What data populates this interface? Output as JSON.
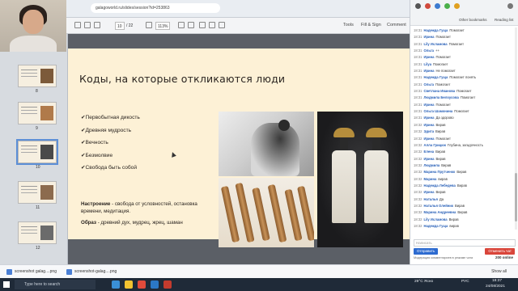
{
  "browser": {
    "address": "galagoworld.ru/slides/session?id=253863"
  },
  "pdf_toolbar": {
    "page_current": "10",
    "page_total": "/ 22",
    "zoom": "113%",
    "tools_label": "Tools",
    "fill_sign_label": "Fill & Sign",
    "comment_label": "Comment"
  },
  "thumbnails": {
    "page_numbers": [
      "8",
      "9",
      "10",
      "11",
      "12"
    ]
  },
  "slide": {
    "title": "Коды, на которые откликаются люди",
    "bullets": [
      "✔Первобытная дикость",
      "✔Древняя мудрость",
      "✔Вечность",
      "✔Безмолвие",
      "✔Свобода быть собой"
    ],
    "mood_label": "Настроение",
    "mood_text": " - свобода от условностей, остановка времени, медитация.",
    "image_label": "Образ",
    "image_text": " - древний дух, мудрец, жрец, шаман"
  },
  "chat": {
    "bookmarks": "Other bookmarks",
    "reading_list": "Reading list",
    "messages": [
      {
        "time": "18:31",
        "name": "Надежда Гуща",
        "text": "Помогает"
      },
      {
        "time": "18:31",
        "name": "Ирина",
        "text": "Помогает"
      },
      {
        "time": "18:31",
        "name": "Lily Исламова",
        "text": "Помогает"
      },
      {
        "time": "18:31",
        "name": "Ольга",
        "text": "++"
      },
      {
        "time": "18:31",
        "name": "Ирина",
        "text": "Помогает"
      },
      {
        "time": "18:31",
        "name": "Lilya",
        "text": "Помогает"
      },
      {
        "time": "18:31",
        "name": "Ирина",
        "text": "Не помогает"
      },
      {
        "time": "18:31",
        "name": "Надежда Гуща",
        "text": "Помогает понять"
      },
      {
        "time": "18:31",
        "name": "Ольга",
        "text": "Помогает"
      },
      {
        "time": "18:31",
        "name": "Светлана Иванова",
        "text": "Помогает"
      },
      {
        "time": "18:31",
        "name": "Людмила Белоусова",
        "text": "Помогает"
      },
      {
        "time": "18:31",
        "name": "Ирина",
        "text": "Помогает"
      },
      {
        "time": "18:31",
        "name": "Ольга Шамонина",
        "text": "Помогает"
      },
      {
        "time": "18:31",
        "name": "Ирина",
        "text": "Да здорово"
      },
      {
        "time": "18:32",
        "name": "Ирина",
        "text": "Вирав"
      },
      {
        "time": "18:32",
        "name": "Эдита",
        "text": "Вирав"
      },
      {
        "time": "18:32",
        "name": "Ирина",
        "text": "Помогает"
      },
      {
        "time": "18:32",
        "name": "Алла Грицюк",
        "text": "Глубина, загадочность"
      },
      {
        "time": "18:32",
        "name": "Елена",
        "text": "Вирав"
      },
      {
        "time": "18:32",
        "name": "Ирина",
        "text": "Вирав"
      },
      {
        "time": "18:32",
        "name": "Людмила",
        "text": "Вирав"
      },
      {
        "time": "18:32",
        "name": "Марина Прутченко",
        "text": "Вирав"
      },
      {
        "time": "18:32",
        "name": "Марина",
        "text": "вирав"
      },
      {
        "time": "18:32",
        "name": "Надежда Лебедева",
        "text": "Вирав"
      },
      {
        "time": "18:32",
        "name": "Ирина",
        "text": "Вирав"
      },
      {
        "time": "18:32",
        "name": "Наталья",
        "text": "Да"
      },
      {
        "time": "18:32",
        "name": "Наталья Олейник",
        "text": "Вирав"
      },
      {
        "time": "18:32",
        "name": "Марина Андреевна",
        "text": "Вирав"
      },
      {
        "time": "18:32",
        "name": "Lily Исламова",
        "text": "Вирав"
      },
      {
        "time": "18:32",
        "name": "Надежда Гуща",
        "text": "вирав"
      },
      {
        "time": "18:32",
        "name": "Наталья Бурова",
        "text": "Вирав"
      },
      {
        "time": "18:32",
        "name": "Ирина",
        "text": "Вирав"
      },
      {
        "time": "18:32",
        "name": "Lilya",
        "text": "Вирав"
      },
      {
        "time": "18:32",
        "name": "Светлана Иванова",
        "text": "Вирав"
      },
      {
        "time": "18:32",
        "name": "Ирина",
        "text": "Символизм"
      },
      {
        "time": "18:32",
        "name": "Ирина",
        "text": "Вирав"
      }
    ],
    "input_placeholder": "Написать",
    "send_label": "Отправить",
    "cancel_label": "Отменить чат",
    "note": "Модерация комментариев в режиме чата",
    "count": "200 online"
  },
  "downloads": {
    "items": [
      "screenshot galag....png",
      "screenshot-galag....png"
    ],
    "show_all": "Show all"
  },
  "taskbar": {
    "search_placeholder": "Type here to search",
    "weather": "29°C Ясно",
    "lang": "РУС",
    "time": "18:37",
    "date": "24/08/2021"
  }
}
